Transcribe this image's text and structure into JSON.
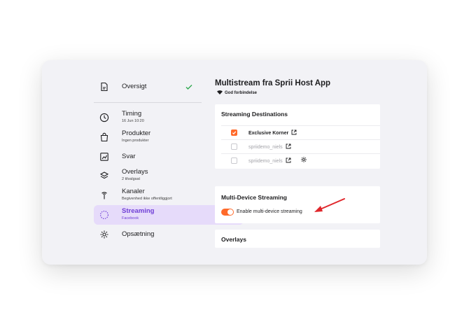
{
  "sidebar": {
    "overview": {
      "label": "Oversigt",
      "icon": "document-icon",
      "check_icon": "checkmark-icon"
    },
    "items": [
      {
        "label": "Timing",
        "sub": "16 Jun 10:20",
        "icon": "clock-icon"
      },
      {
        "label": "Produkter",
        "sub": "Ingen produkter",
        "icon": "shopping-bag-icon"
      },
      {
        "label": "Svar",
        "sub": "",
        "icon": "chart-icon"
      },
      {
        "label": "Overlays",
        "sub": "2 tilvalgsat",
        "icon": "layers-icon"
      },
      {
        "label": "Kanaler",
        "sub": "Begivenhed ikke offentliggjort",
        "icon": "antenna-icon"
      },
      {
        "label": "Streaming",
        "sub": "Facebook",
        "icon": "streaming-icon",
        "active": true
      },
      {
        "label": "Opsætning",
        "sub": "",
        "icon": "gear-icon"
      }
    ]
  },
  "main": {
    "title": "Multistream fra Sprii Host App",
    "connection": "God forbindelse",
    "streaming_destinations": {
      "title": "Streaming Destinations",
      "rows": [
        {
          "name": "Exclusive Korner",
          "checked": true
        },
        {
          "name": "spriidemo_niels",
          "checked": false
        },
        {
          "name": "spriidemo_niels",
          "checked": false,
          "has_settings": true
        }
      ]
    },
    "multi_device": {
      "title": "Multi-Device Streaming",
      "toggle_label": "Enable multi-device streaming",
      "enabled": true
    },
    "overlays": {
      "title": "Overlays"
    }
  },
  "colors": {
    "accent": "#ff6a2b",
    "active_bg": "#e6dbfa",
    "active_text": "#6f3ed6",
    "annotation_arrow": "#e0262b",
    "window_bg": "#f2f2f6"
  }
}
